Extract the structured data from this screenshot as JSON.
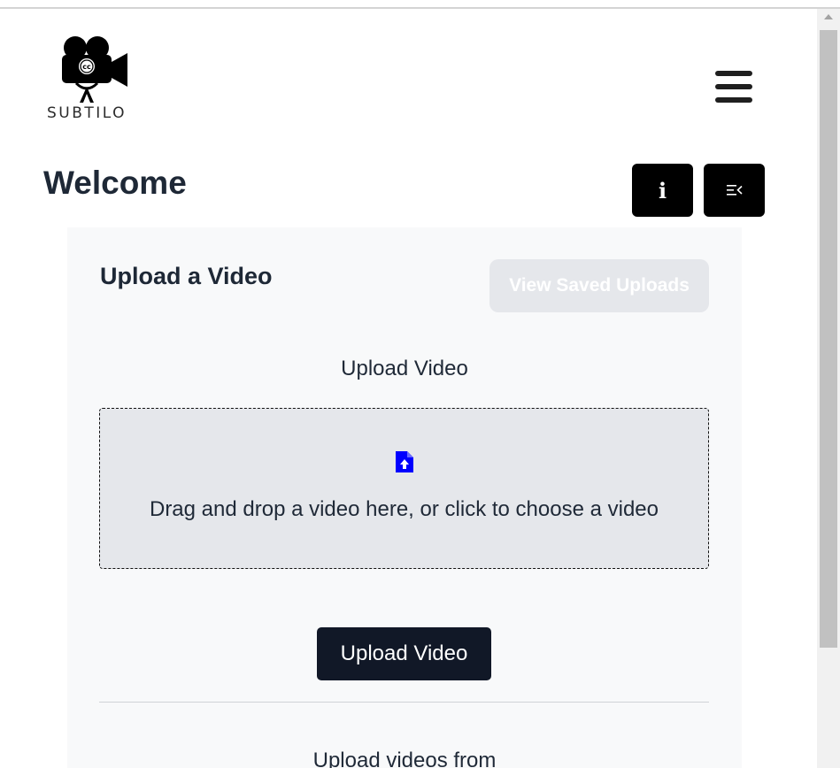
{
  "brand": {
    "name": "SUBTILO",
    "logo_icon": "movie-camera-cc-icon"
  },
  "header": {
    "menu_icon": "hamburger-menu-icon"
  },
  "page": {
    "title": "Welcome",
    "info_button_glyph": "i",
    "info_icon": "info-icon",
    "queue_icon": "playlist-collapse-icon"
  },
  "upload_card": {
    "title": "Upload a Video",
    "view_saved_label": "View Saved Uploads",
    "upload_label": "Upload Video",
    "dropzone_text": "Drag and drop a video here, or click to choose a video",
    "dropzone_icon": "file-upload-icon",
    "upload_button_label": "Upload Video",
    "from_label": "Upload videos from"
  },
  "colors": {
    "primary_dark": "#111827",
    "black": "#000000",
    "card_bg": "#f8f9fa",
    "dropzone_bg": "#e5e7eb",
    "disabled_button": "#e5e7eb",
    "upload_icon_blue": "#0000ff"
  }
}
